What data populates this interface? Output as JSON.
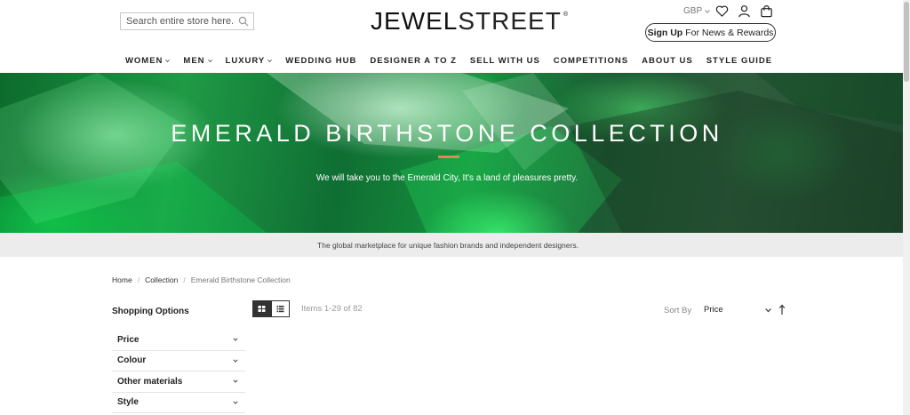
{
  "header": {
    "search_placeholder": "Search entire store here...",
    "logo_part1": "JEWEL",
    "logo_part2": "STREET",
    "logo_mark": "®",
    "currency": "GBP",
    "icons": [
      "heart-icon",
      "user-icon",
      "bag-icon"
    ],
    "signup_bold": "Sign Up",
    "signup_rest": "For News & Rewards"
  },
  "nav": {
    "items": [
      {
        "label": "WOMEN",
        "dropdown": true
      },
      {
        "label": "MEN",
        "dropdown": true
      },
      {
        "label": "LUXURY",
        "dropdown": true
      },
      {
        "label": "WEDDING HUB",
        "dropdown": false
      },
      {
        "label": "DESIGNER A TO Z",
        "dropdown": false
      },
      {
        "label": "SELL WITH US",
        "dropdown": false
      },
      {
        "label": "COMPETITIONS",
        "dropdown": false
      },
      {
        "label": "ABOUT US",
        "dropdown": false
      },
      {
        "label": "STYLE GUIDE",
        "dropdown": false
      }
    ]
  },
  "hero": {
    "title": "EMERALD BIRTHSTONE COLLECTION",
    "subtitle": "We will take you to the Emerald City, It's a land of pleasures pretty.",
    "accent_color": "#d98a5a"
  },
  "tagline": "The global marketplace for unique fashion brands and independent designers.",
  "breadcrumb": {
    "home": "Home",
    "collection": "Collection",
    "current": "Emerald Birthstone Collection"
  },
  "sidebar": {
    "title": "Shopping Options",
    "filters": [
      "Price",
      "Colour",
      "Other materials",
      "Style"
    ]
  },
  "toolbar": {
    "items_count": "Items 1-29 of 82",
    "sort_label": "Sort By",
    "sort_value": "Price",
    "view_modes": [
      "grid-view-icon",
      "list-view-icon"
    ],
    "active_view": "grid"
  }
}
